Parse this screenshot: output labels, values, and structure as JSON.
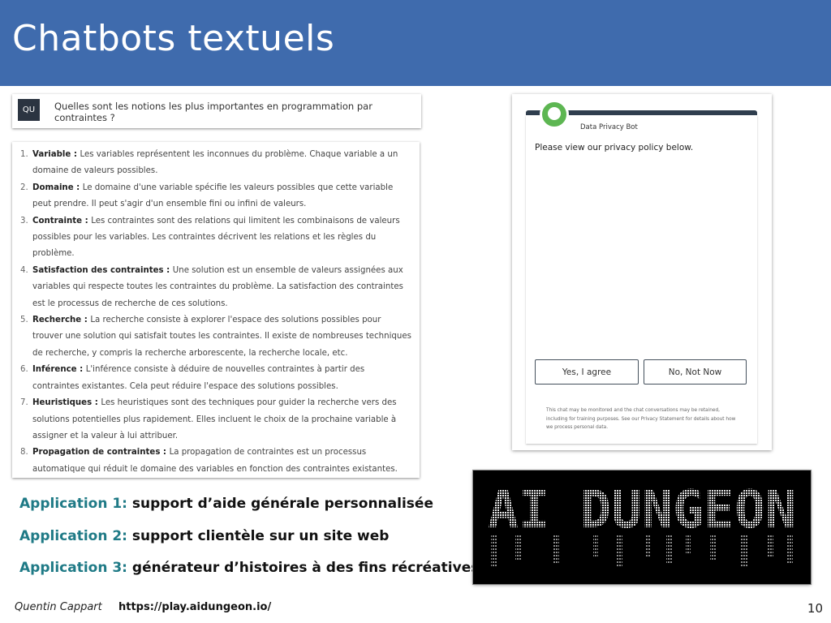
{
  "slide": {
    "title": "Chatbots textuels",
    "page_number": "10",
    "author": "Quentin Cappart",
    "link": "https://play.aidungeon.io/"
  },
  "question": {
    "avatar_initials": "QU",
    "text": "Quelles sont les notions les plus importantes en programmation par contraintes ?"
  },
  "answer": {
    "items": [
      {
        "num": "1.",
        "term": "Variable",
        "sep": " : ",
        "text": "Les variables représentent les inconnues du problème. Chaque variable a un domaine de valeurs possibles."
      },
      {
        "num": "2.",
        "term": "Domaine",
        "sep": " : ",
        "text": "Le domaine d'une variable spécifie les valeurs possibles que cette variable peut prendre. Il peut s'agir d'un ensemble fini ou infini de valeurs."
      },
      {
        "num": "3.",
        "term": "Contrainte",
        "sep": " : ",
        "text": "Les contraintes sont des relations qui limitent les combinaisons de valeurs possibles pour les variables. Les contraintes décrivent les relations et les règles du problème."
      },
      {
        "num": "4.",
        "term": "Satisfaction des contraintes",
        "sep": " : ",
        "text": "Une solution est un ensemble de valeurs assignées aux variables qui respecte toutes les contraintes du problème. La satisfaction des contraintes est le processus de recherche de ces solutions."
      },
      {
        "num": "5.",
        "term": "Recherche",
        "sep": " : ",
        "text": "La recherche consiste à explorer l'espace des solutions possibles pour trouver une solution qui satisfait toutes les contraintes. Il existe de nombreuses techniques de recherche, y compris la recherche arborescente, la recherche locale, etc."
      },
      {
        "num": "6.",
        "term": "Inférence",
        "sep": " : ",
        "text": "L'inférence consiste à déduire de nouvelles contraintes à partir des contraintes existantes. Cela peut réduire l'espace des solutions possibles."
      },
      {
        "num": "7.",
        "term": "Heuristiques",
        "sep": " : ",
        "text": "Les heuristiques sont des techniques pour guider la recherche vers des solutions potentielles plus rapidement. Elles incluent le choix de la prochaine variable à assigner et la valeur à lui attribuer."
      },
      {
        "num": "8.",
        "term": "Propagation de contraintes",
        "sep": " : ",
        "text": "La propagation de contraintes est un processus automatique qui réduit le domaine des variables en fonction des contraintes existantes."
      }
    ]
  },
  "privacy_bot": {
    "name": "Data Privacy Bot",
    "message": "Please view our privacy policy below.",
    "agree_label": "Yes, I agree",
    "decline_label": "No, Not Now",
    "footer": "This chat may be monitored and the chat conversations may be retained, including for training purposes. See our Privacy Statement for details about how we process personal data.",
    "logo_color": "#5db652"
  },
  "applications": [
    {
      "label": "Application 1:",
      "text": "support d’aide générale personnalisée"
    },
    {
      "label": "Application 2:",
      "text": "support clientèle sur un site web"
    },
    {
      "label": "Application 3:",
      "text": "générateur d’histoires à des fins récréatives"
    }
  ],
  "logo": {
    "text": "AI DUNGEON"
  },
  "colors": {
    "title_bar": "#3f6bad",
    "application_label": "#1f7a86"
  }
}
